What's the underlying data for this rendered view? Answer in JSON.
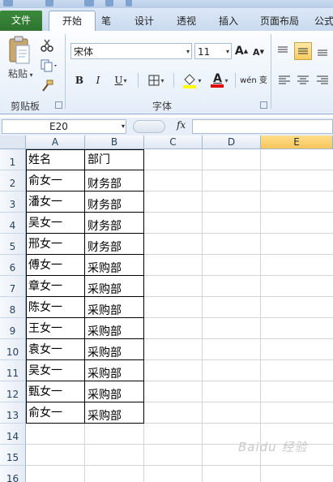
{
  "ribbon_tabs": [
    "文件",
    "开始",
    "笔",
    "设计",
    "透视",
    "插入",
    "页面布局",
    "公式"
  ],
  "clipboard": {
    "paste_label": "粘贴",
    "group_label": "剪贴板"
  },
  "font": {
    "name": "宋体",
    "size": "11",
    "group_label": "字体",
    "bold": "B",
    "italic": "I",
    "underline": "U",
    "wen": "wén 变",
    "color_letter": "A",
    "grow": "A",
    "shrink": "A"
  },
  "formula_bar": {
    "name_box": "E20",
    "fx": "fx",
    "formula": ""
  },
  "column_headers": [
    "A",
    "B",
    "C",
    "D",
    "E"
  ],
  "active_column": "E",
  "row_headers": [
    "1",
    "2",
    "3",
    "4",
    "5",
    "6",
    "7",
    "8",
    "9",
    "10",
    "11",
    "12",
    "13",
    "14",
    "15",
    "16"
  ],
  "table": {
    "header": [
      "姓名",
      "部门"
    ],
    "rows": [
      [
        "俞女一",
        "财务部"
      ],
      [
        "潘女一",
        "财务部"
      ],
      [
        "吴女一",
        "财务部"
      ],
      [
        "邢女一",
        "财务部"
      ],
      [
        "傅女一",
        "采购部"
      ],
      [
        "章女一",
        "采购部"
      ],
      [
        "陈女一",
        "采购部"
      ],
      [
        "王女一",
        "采购部"
      ],
      [
        "袁女一",
        "采购部"
      ],
      [
        "吴女一",
        "采购部"
      ],
      [
        "甄女一",
        "采购部"
      ],
      [
        "俞女一",
        "采购部"
      ]
    ]
  },
  "watermark": "Baidu 经验",
  "colors": {
    "file_tab": "#2e7430",
    "active_column_header": "#f7c55a",
    "ribbon_bg": "#e4edf8"
  }
}
